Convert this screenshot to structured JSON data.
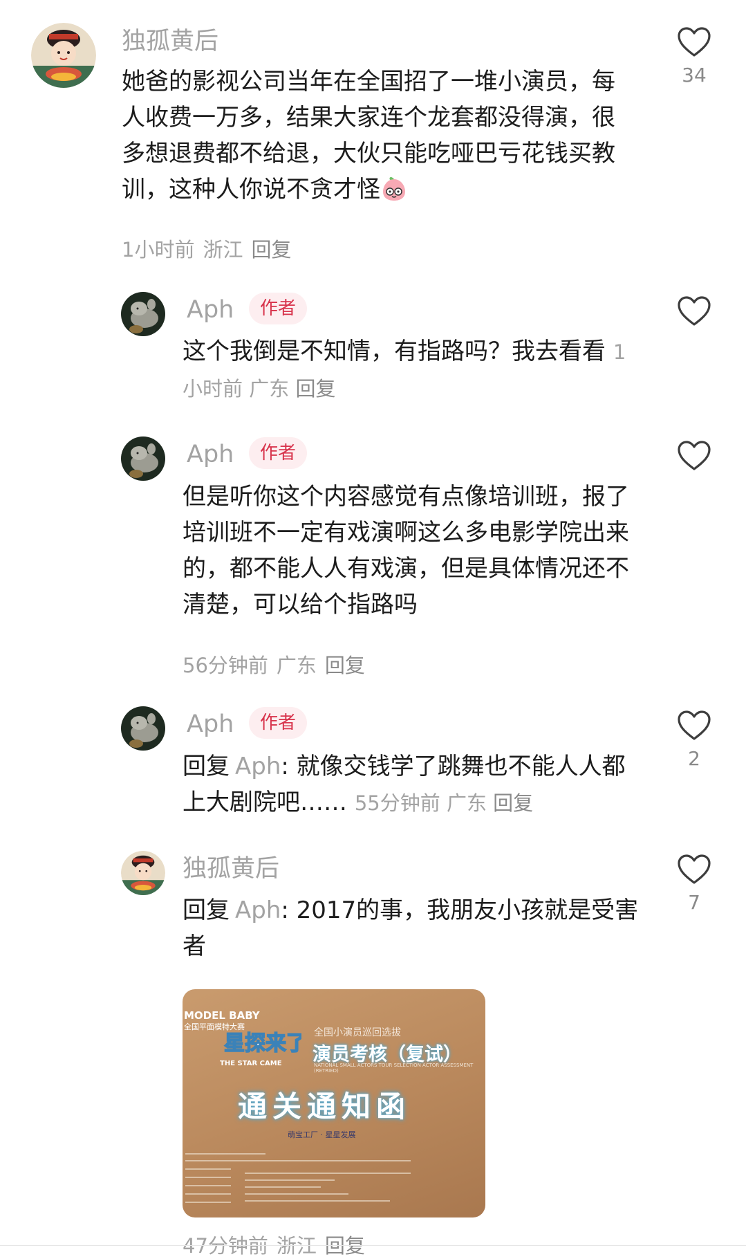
{
  "comments": [
    {
      "name": "独孤黄后",
      "text": "她爸的影视公司当年在全国招了一堆小演员，每人收费一万多，结果大家连个龙套都没得演，很多想退费都不给退，大伙只能吃哑巴亏花钱买教训，这种人你说不贪才怪",
      "time": "1小时前",
      "location": "浙江",
      "reply_label": "回复",
      "likes": "34"
    },
    {
      "name": "Aph",
      "badge": "作者",
      "text": "这个我倒是不知情，有指路吗？我去看看",
      "time": "1小时前",
      "location": "广东",
      "reply_label": "回复",
      "likes": ""
    },
    {
      "name": "Aph",
      "badge": "作者",
      "text": "但是听你这个内容感觉有点像培训班，报了培训班不一定有戏演啊这么多电影学院出来的，都不能人人有戏演，但是具体情况还不清楚，可以给个指路吗",
      "time": "56分钟前",
      "location": "广东",
      "reply_label": "回复",
      "likes": ""
    },
    {
      "name": "Aph",
      "badge": "作者",
      "reply_prefix": "回复",
      "reply_to": "Aph",
      "text": ": 就像交钱学了跳舞也不能人人都上大剧院吧……",
      "time": "55分钟前",
      "location": "广东",
      "reply_label": "回复",
      "likes": "2"
    },
    {
      "name": "独孤黄后",
      "reply_prefix": "回复",
      "reply_to": "Aph",
      "text": ": 2017的事，我朋友小孩就是受害者",
      "time": "47分钟前",
      "location": "浙江",
      "reply_label": "回复",
      "likes": "7"
    }
  ],
  "photo": {
    "brand_line1": "MODEL BABY",
    "brand_line2": "全国平面模特大赛",
    "logo_text_main": "星探来了!",
    "logo_text_en": "THE STAR CAME",
    "subtitle": "全国小演员巡回选拔",
    "title1": "演员考核（复试）",
    "tiny": "NATIONAL SMALL ACTORS TOUR SELECTION ACTOR ASSESSMENT (RETRIED)",
    "title2": "通关通知函",
    "sponsors": "萌宝工厂  ·  星星发展"
  },
  "colors": {
    "meta_gray": "#a3a3a3",
    "badge_red": "#d8344c",
    "badge_bg": "#fdeef0"
  }
}
